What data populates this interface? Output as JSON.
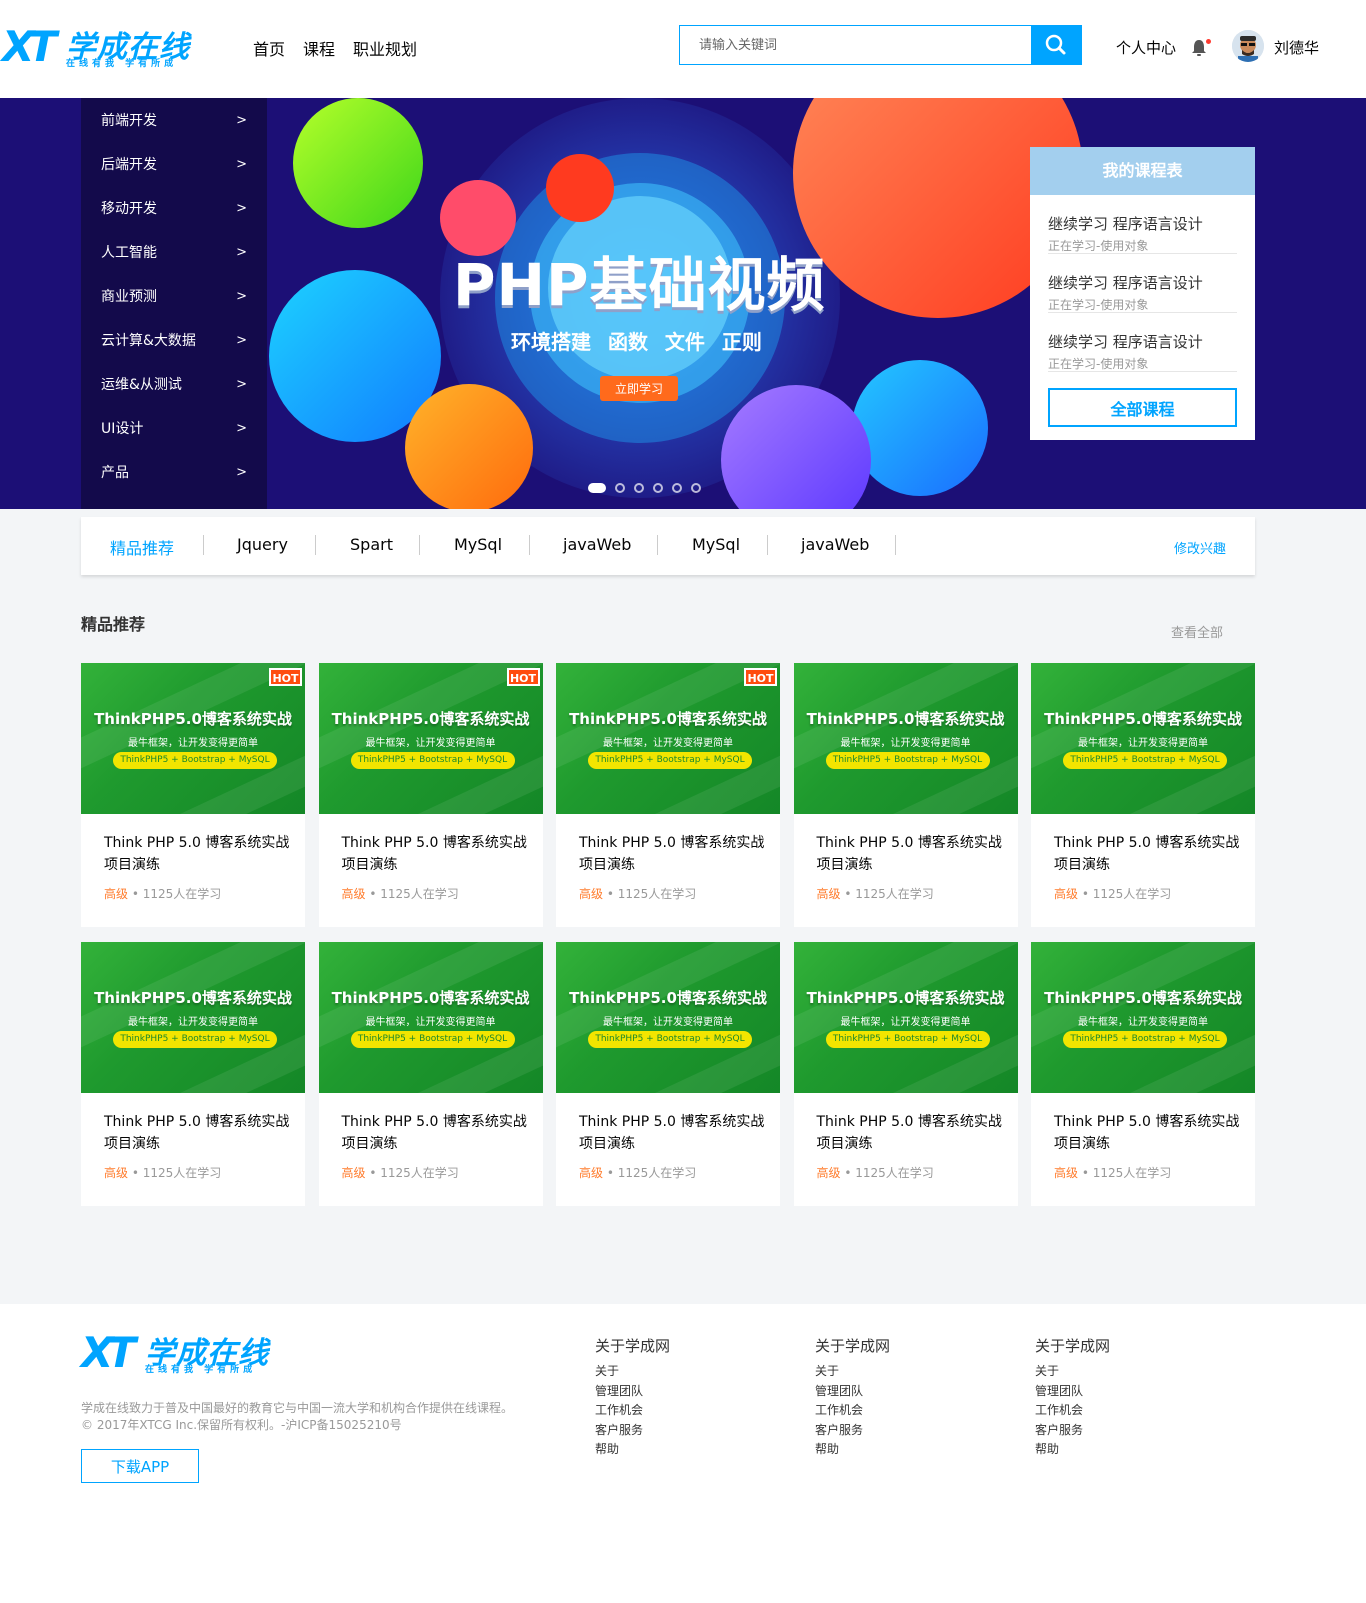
{
  "header": {
    "logo_name": "学成在线",
    "logo_sub": "在线有我 学有所成",
    "nav": [
      "首页",
      "课程",
      "职业规划"
    ],
    "search_placeholder": "请输入关键词",
    "user_center": "个人中心",
    "username": "刘德华"
  },
  "colors": {
    "brand": "#00a4ff",
    "accent": "#ff6a1c",
    "banner_bg": "#1c0f76"
  },
  "banner": {
    "categories": [
      "前端开发",
      "后端开发",
      "移动开发",
      "人工智能",
      "商业预测",
      "云计算&大数据",
      "运维&从测试",
      "UI设计",
      "产品"
    ],
    "arrow": ">",
    "title": "PHP基础视频",
    "subtitle": "环境搭建 函数 文件 正则",
    "cta": "立即学习",
    "slide_count": 6,
    "active_slide": 1
  },
  "schedule": {
    "title": "我的课程表",
    "items": [
      {
        "title": "继续学习 程序语言设计",
        "sub": "正在学习-使用对象"
      },
      {
        "title": "继续学习 程序语言设计",
        "sub": "正在学习-使用对象"
      },
      {
        "title": "继续学习 程序语言设计",
        "sub": "正在学习-使用对象"
      }
    ],
    "all_button": "全部课程"
  },
  "tagbar": {
    "tags": [
      "精品推荐",
      "Jquery",
      "Spart",
      "MySql",
      "javaWeb",
      "MySql",
      "javaWeb"
    ],
    "edit": "修改兴趣"
  },
  "section": {
    "title": "精品推荐",
    "view_all": "查看全部"
  },
  "course_image": {
    "title": "ThinkPHP5.0博客系统实战",
    "sub": "最牛框架，让开发变得更简单",
    "pill": "ThinkPHP5 + Bootstrap + MySQL",
    "hot": "HOT"
  },
  "courses": [
    {
      "hot": true,
      "title": "Think PHP 5.0 博客系统实战项目演练",
      "level": "高级",
      "learners": "1125人在学习"
    },
    {
      "hot": true,
      "title": "Think PHP 5.0 博客系统实战项目演练",
      "level": "高级",
      "learners": "1125人在学习"
    },
    {
      "hot": true,
      "title": "Think PHP 5.0 博客系统实战项目演练",
      "level": "高级",
      "learners": "1125人在学习"
    },
    {
      "hot": false,
      "title": "Think PHP 5.0 博客系统实战项目演练",
      "level": "高级",
      "learners": "1125人在学习"
    },
    {
      "hot": false,
      "title": "Think PHP 5.0 博客系统实战项目演练",
      "level": "高级",
      "learners": "1125人在学习"
    },
    {
      "hot": false,
      "title": "Think PHP 5.0 博客系统实战项目演练",
      "level": "高级",
      "learners": "1125人在学习"
    },
    {
      "hot": false,
      "title": "Think PHP 5.0 博客系统实战项目演练",
      "level": "高级",
      "learners": "1125人在学习"
    },
    {
      "hot": false,
      "title": "Think PHP 5.0 博客系统实战项目演练",
      "level": "高级",
      "learners": "1125人在学习"
    },
    {
      "hot": false,
      "title": "Think PHP 5.0 博客系统实战项目演练",
      "level": "高级",
      "learners": "1125人在学习"
    },
    {
      "hot": false,
      "title": "Think PHP 5.0 博客系统实战项目演练",
      "level": "高级",
      "learners": "1125人在学习"
    }
  ],
  "footer": {
    "desc_line1": "学成在线致力于普及中国最好的教育它与中国一流大学和机构合作提供在线课程。",
    "desc_line2": "© 2017年XTCG Inc.保留所有权利。-沪ICP备15025210号",
    "download": "下载APP",
    "columns": [
      {
        "title": "关于学成网",
        "links": [
          "关于",
          "管理团队",
          "工作机会",
          "客户服务",
          "帮助"
        ]
      },
      {
        "title": "关于学成网",
        "links": [
          "关于",
          "管理团队",
          "工作机会",
          "客户服务",
          "帮助"
        ]
      },
      {
        "title": "关于学成网",
        "links": [
          "关于",
          "管理团队",
          "工作机会",
          "客户服务",
          "帮助"
        ]
      }
    ]
  }
}
